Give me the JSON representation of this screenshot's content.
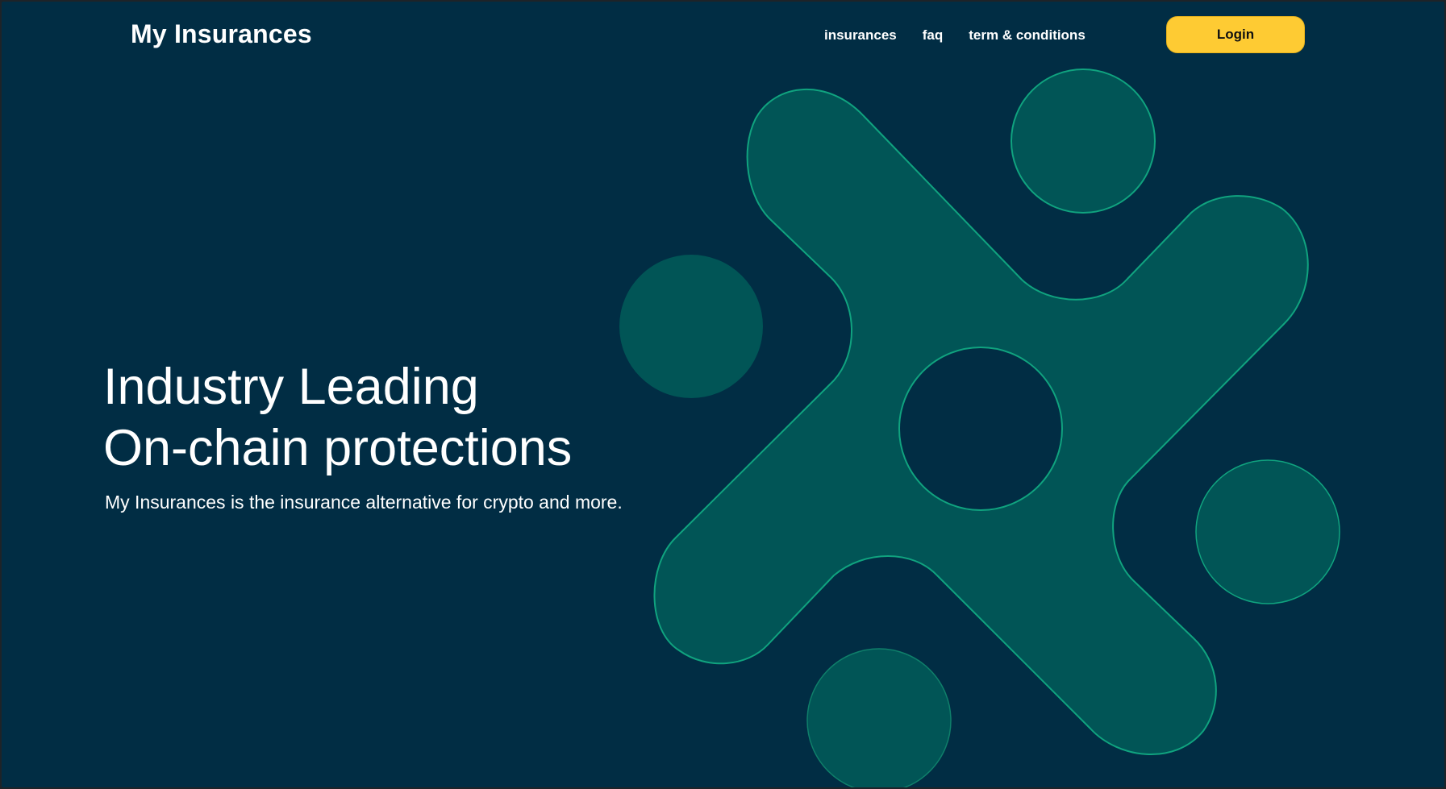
{
  "header": {
    "brand": "My Insurances",
    "nav": [
      {
        "label": "insurances"
      },
      {
        "label": "faq"
      },
      {
        "label": "term & conditions"
      }
    ],
    "login_label": "Login"
  },
  "hero": {
    "title_line1": "Industry Leading",
    "title_line2": "On-chain protections",
    "subtitle": "My Insurances is the insurance alternative for crypto and more."
  },
  "colors": {
    "background": "#012d44",
    "shape_fill": "#015556",
    "shape_outline": "#10a37f",
    "accent": "#fecb33",
    "text": "#ffffff"
  },
  "icons": {
    "hero_graphic": "abstract-x-shape-icon"
  }
}
